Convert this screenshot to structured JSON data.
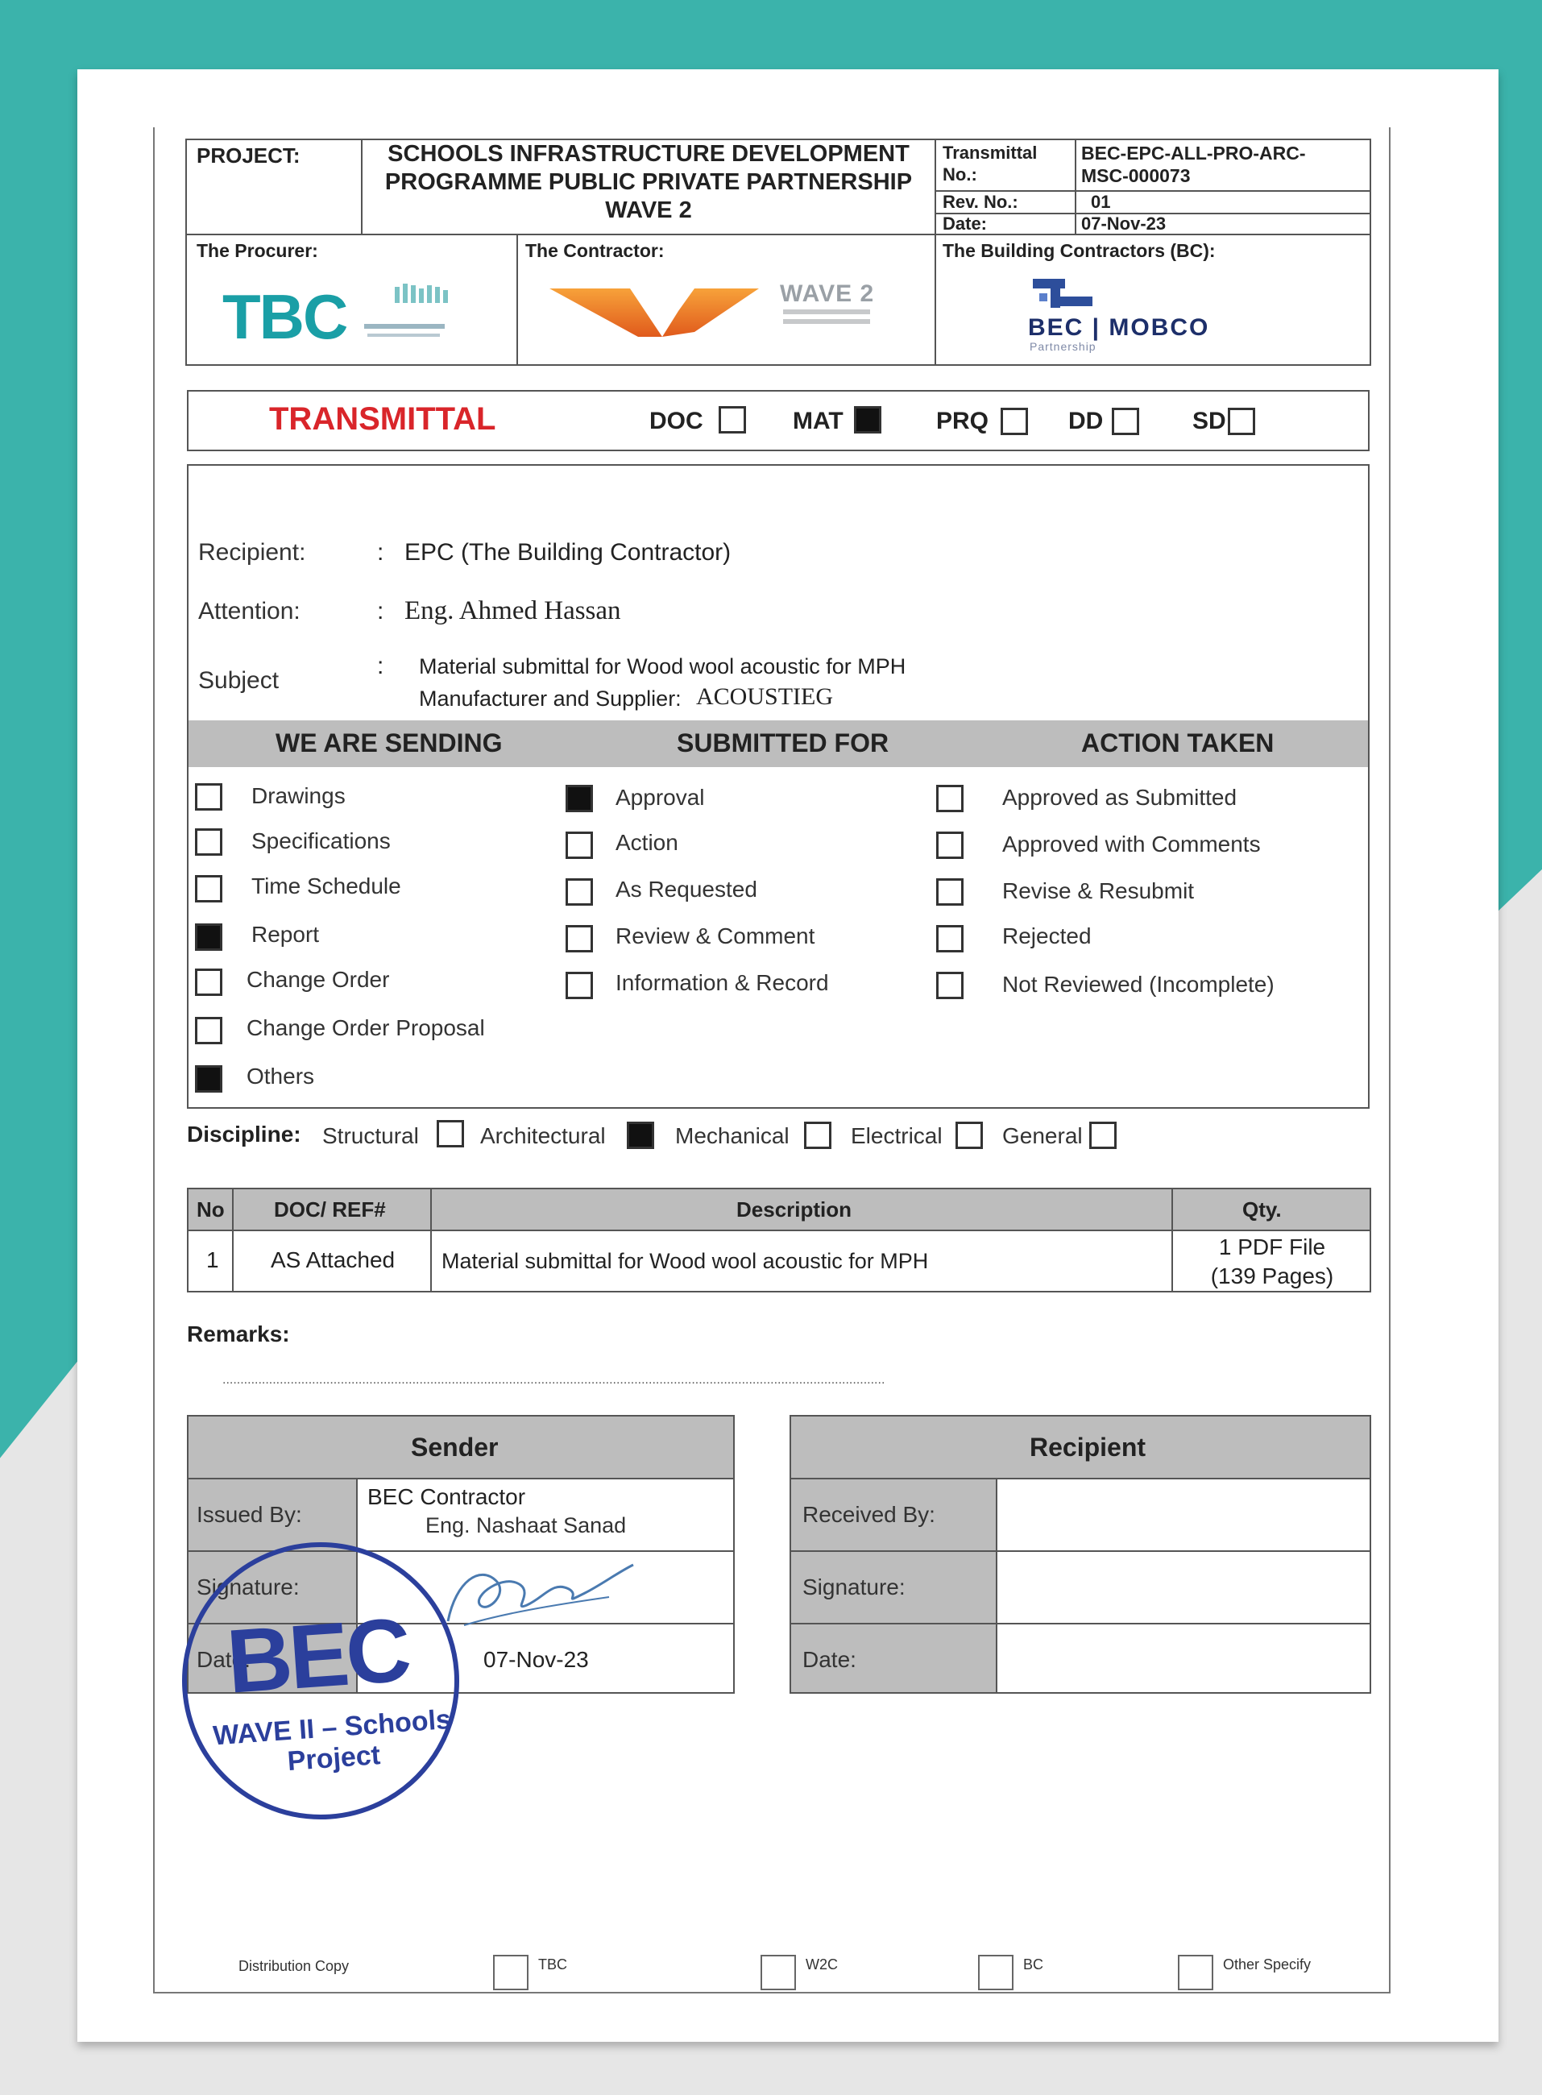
{
  "header": {
    "project_label": "PROJECT:",
    "project_title": [
      "SCHOOLS INFRASTRUCTURE DEVELOPMENT",
      "PROGRAMME PUBLIC PRIVATE PARTNERSHIP",
      "WAVE 2"
    ],
    "transmittal_no_label": [
      "Transmittal",
      "No.:"
    ],
    "transmittal_no_value": [
      "BEC-EPC-ALL-PRO-ARC-",
      "MSC-000073"
    ],
    "rev_label": "Rev. No.:",
    "rev_value": "01",
    "date_label": "Date:",
    "date_value": "07-Nov-23",
    "procurer_label": "The Procurer:",
    "contractor_label": "The Contractor:",
    "bc_label": "The Building Contractors (BC):"
  },
  "logos": {
    "tbc": "TBC",
    "wave2": "WAVE 2",
    "bec_mobco": "BEC | MOBCO",
    "partnership": "Partnership"
  },
  "type_row": {
    "title": "TRANSMITTAL",
    "title_color": "#d9252a",
    "options": [
      {
        "label": "DOC",
        "checked": false
      },
      {
        "label": "MAT",
        "checked": true
      },
      {
        "label": "PRQ",
        "checked": false
      },
      {
        "label": "DD",
        "checked": false
      },
      {
        "label": "SD",
        "checked": false
      }
    ]
  },
  "info": {
    "recipient_label": "Recipient:",
    "recipient_value": "EPC (The Building Contractor)",
    "attention_label": "Attention:",
    "attention_value": "Eng. Ahmed Hassan",
    "subject_label": "Subject",
    "subject_line1": "Material submittal for  Wood wool acoustic for MPH",
    "subject_line2_prefix": "Manufacturer and Supplier:",
    "subject_line2_value": "ACOUSTIEG",
    "colon": ":"
  },
  "sections": {
    "headers": [
      "WE ARE SENDING",
      "SUBMITTED FOR",
      "ACTION TAKEN"
    ],
    "sending": [
      {
        "label": "Drawings",
        "checked": false
      },
      {
        "label": "Specifications",
        "checked": false
      },
      {
        "label": "Time Schedule",
        "checked": false
      },
      {
        "label": "Report",
        "checked": true
      },
      {
        "label": "Change Order",
        "checked": false
      },
      {
        "label": "Change Order Proposal",
        "checked": false
      },
      {
        "label": "Others",
        "checked": true
      }
    ],
    "submitted": [
      {
        "label": "Approval",
        "checked": true
      },
      {
        "label": "Action",
        "checked": false
      },
      {
        "label": "As Requested",
        "checked": false
      },
      {
        "label": "Review & Comment",
        "checked": false
      },
      {
        "label": "Information & Record",
        "checked": false
      }
    ],
    "action": [
      {
        "label": "Approved as Submitted",
        "checked": false
      },
      {
        "label": "Approved with Comments",
        "checked": false
      },
      {
        "label": "Revise & Resubmit",
        "checked": false
      },
      {
        "label": "Rejected",
        "checked": false
      },
      {
        "label": "Not Reviewed (Incomplete)",
        "checked": false
      }
    ]
  },
  "discipline": {
    "label": "Discipline:",
    "options": [
      {
        "label": "Structural",
        "checked": false
      },
      {
        "label": "Architectural",
        "checked": true
      },
      {
        "label": "Mechanical",
        "checked": false
      },
      {
        "label": "Electrical",
        "checked": false
      },
      {
        "label": "General",
        "checked": false
      }
    ]
  },
  "items_table": {
    "headers": [
      "No",
      "DOC/ REF#",
      "Description",
      "Qty."
    ],
    "rows": [
      {
        "no": "1",
        "ref": "AS Attached",
        "description": "Material submittal for  Wood wool acoustic for MPH",
        "qty_line1": "1 PDF File",
        "qty_line2": "(139 Pages)"
      }
    ]
  },
  "remarks": {
    "label": "Remarks:",
    "dots": "........................................................................................................................................................................................."
  },
  "sender": {
    "title": "Sender",
    "issued_by_label": "Issued By:",
    "issued_by_line1": "BEC Contractor",
    "issued_by_line2": "Eng. Nashaat Sanad",
    "signature_label": "Signature:",
    "date_label": "Date:",
    "date_value": "07-Nov-23"
  },
  "recipient_box": {
    "title": "Recipient",
    "received_by_label": "Received By:",
    "signature_label": "Signature:",
    "date_label": "Date:"
  },
  "stamp": {
    "name": "BEC",
    "line1": "WAVE II – Schools",
    "line2": "Project",
    "color": "#2b3f9c"
  },
  "distribution": {
    "label": "Distribution Copy",
    "options": [
      "TBC",
      "W2C",
      "BC",
      "Other Specify"
    ]
  }
}
